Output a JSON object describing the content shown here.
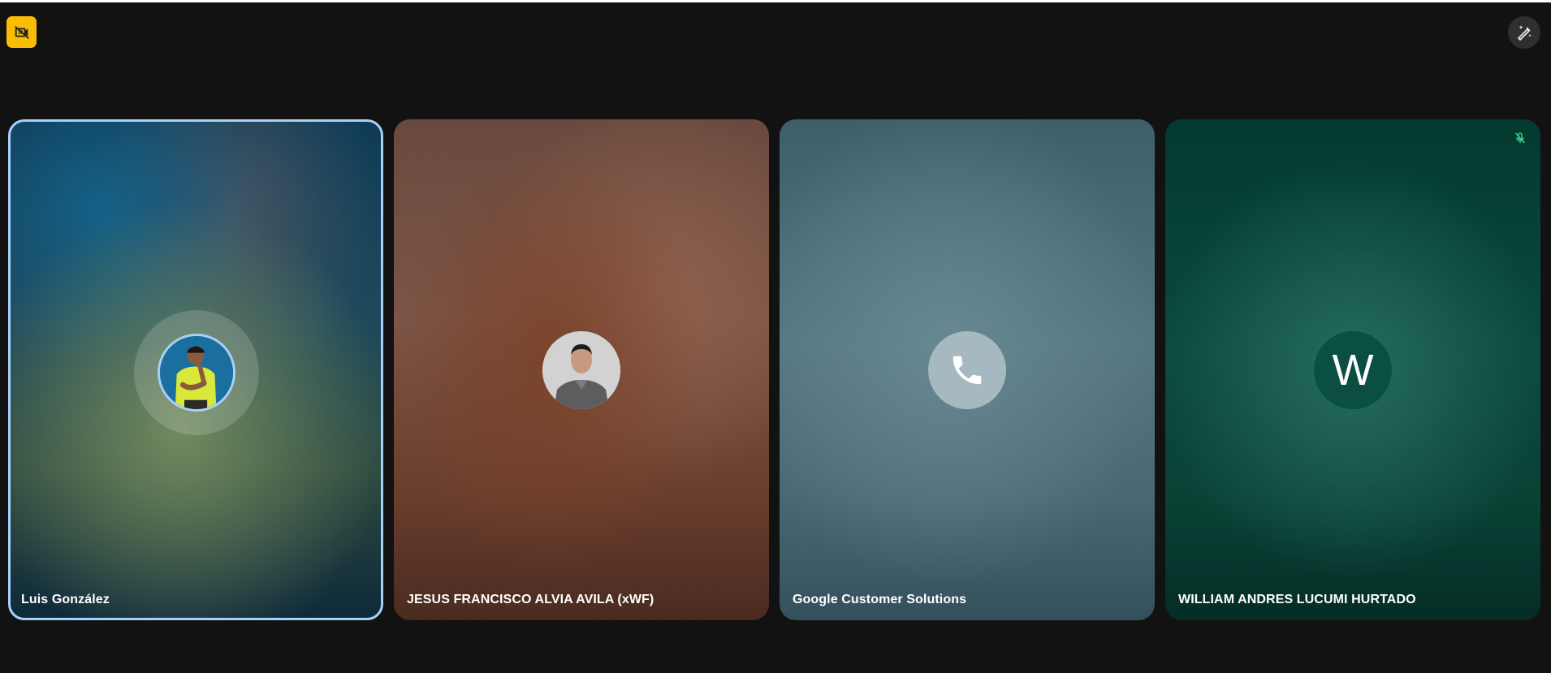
{
  "toolbar": {
    "left_icon": "video-off-icon",
    "right_icon": "magic-pen-icon"
  },
  "tiles": [
    {
      "name": "Luis González",
      "avatar_type": "photo",
      "speaking": true,
      "accent_color": "#a8d1f8"
    },
    {
      "name": "JESUS FRANCISCO ALVIA AVILA (xWF)",
      "avatar_type": "photo"
    },
    {
      "name": "Google Customer Solutions",
      "avatar_type": "phone-icon"
    },
    {
      "name": "WILLIAM ANDRES LUCUMI HURTADO",
      "avatar_type": "initial",
      "initial": "W",
      "muted": true,
      "mute_icon": "mic-off-icon",
      "mute_color": "#3ddc97"
    }
  ],
  "colors": {
    "background": "#121212",
    "badge": "#fbbc04",
    "speaking_border": "#a8d1f8"
  }
}
